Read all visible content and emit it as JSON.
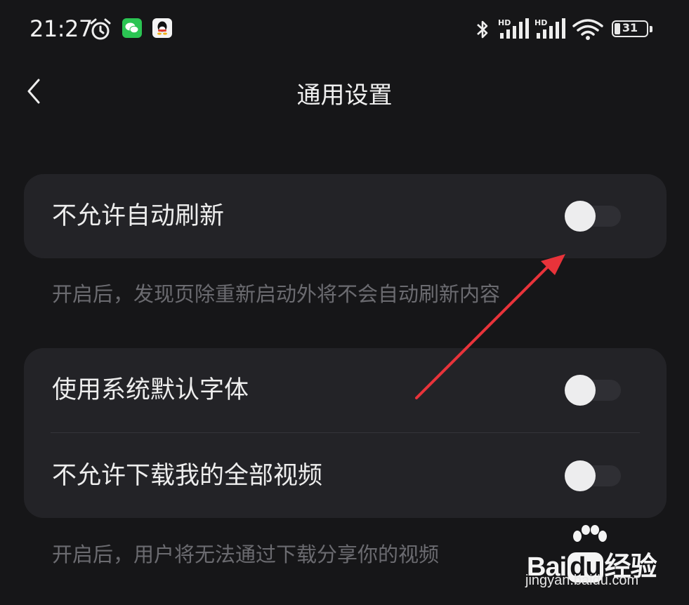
{
  "status_bar": {
    "time": "21:27",
    "battery": "31",
    "signal_label_1": "HD",
    "signal_label_2": "HD",
    "icons": [
      "alarm-icon",
      "wechat-icon",
      "qq-icon",
      "bluetooth-icon",
      "signal-icon",
      "signal-icon",
      "wifi-icon",
      "battery-icon"
    ]
  },
  "header": {
    "title": "通用设置",
    "back_icon": "chevron-left-icon"
  },
  "settings": {
    "group1": {
      "auto_refresh": {
        "label": "不允许自动刷新",
        "enabled": false
      },
      "description": "开启后，发现页除重新启动外将不会自动刷新内容"
    },
    "group2": {
      "system_font": {
        "label": "使用系统默认字体",
        "enabled": false
      },
      "disable_download": {
        "label": "不允许下载我的全部视频",
        "enabled": false
      },
      "description": "开启后，用户将无法通过下载分享你的视频"
    }
  },
  "watermark": {
    "brand_prefix": "Bai",
    "brand_du": "du",
    "brand_suffix": "经验",
    "url": "jingyan.baidu.com"
  },
  "colors": {
    "background": "#161618",
    "card": "#232327",
    "toggle_knob": "#ededee",
    "toggle_track": "#2f2f34",
    "description_text": "#6b6b70",
    "annotation_arrow": "#e8333a"
  }
}
